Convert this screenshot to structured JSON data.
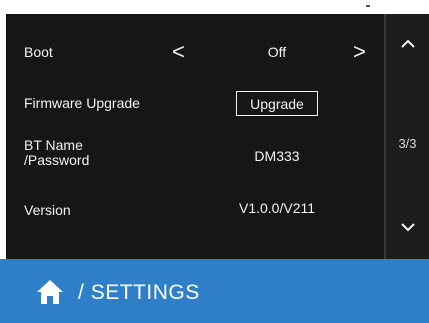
{
  "settings": {
    "boot": {
      "label": "Boot",
      "prev": "<",
      "value": "Off",
      "next": ">"
    },
    "firmware": {
      "label": "Firmware Upgrade",
      "button": "Upgrade"
    },
    "bt": {
      "label_line1": "BT Name",
      "label_line2": "/Password",
      "value": "DM333"
    },
    "version": {
      "label": "Version",
      "value": "V1.0.0/V211"
    }
  },
  "pager": {
    "page": "3/3",
    "up_icon": "chevron-up-icon",
    "down_icon": "chevron-down-icon"
  },
  "footer": {
    "icon": "home-icon",
    "separator": "/",
    "title": "SETTINGS"
  },
  "colors": {
    "screen_bg": "#161616",
    "footer_bg": "#2f7fc8",
    "text": "#f2f2f2"
  }
}
